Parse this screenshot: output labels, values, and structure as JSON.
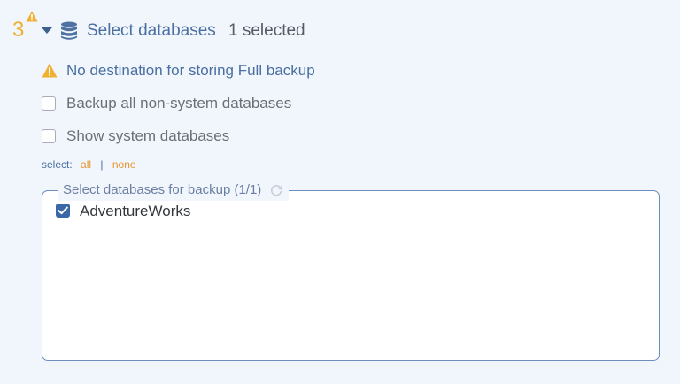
{
  "step": {
    "number": "3",
    "title": "Select databases",
    "selected_count": "1 selected",
    "icons": {
      "warning": "warning-triangle-icon",
      "toggle": "caret-down-icon",
      "section": "database-icon"
    },
    "colors": {
      "number": "#f0b030",
      "title": "#4a6fa1"
    }
  },
  "warning": {
    "icon": "warning-triangle-icon",
    "text": "No destination for storing Full backup",
    "color": "#f0b030"
  },
  "options": [
    {
      "label": "Backup all non-system databases",
      "checked": false
    },
    {
      "label": "Show system databases",
      "checked": false
    }
  ],
  "select": {
    "label": "select:",
    "all": "all",
    "separator": "|",
    "none": "none",
    "link_color": "#e8952e"
  },
  "database_list": {
    "legend": "Select databases for backup (1/1)",
    "refresh_icon": "refresh-icon",
    "items": [
      {
        "name": "AdventureWorks",
        "checked": true
      }
    ],
    "accent": "#3a67a8"
  }
}
